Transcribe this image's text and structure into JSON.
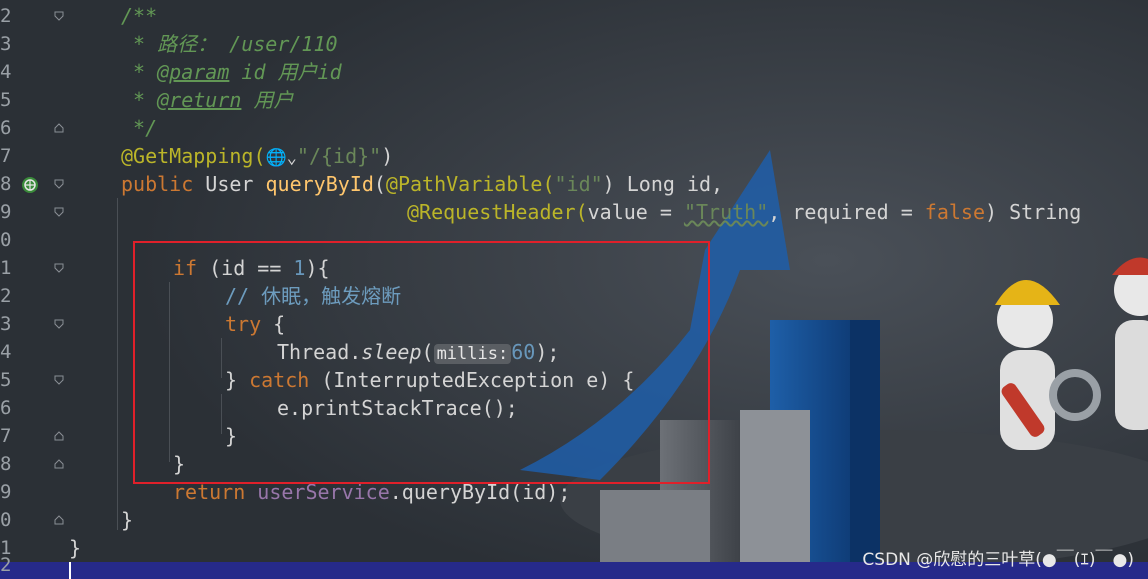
{
  "editor": {
    "lines": [
      {
        "num": "2"
      },
      {
        "num": "3"
      },
      {
        "num": "4"
      },
      {
        "num": "5"
      },
      {
        "num": "6"
      },
      {
        "num": "7"
      },
      {
        "num": "8"
      },
      {
        "num": "9"
      },
      {
        "num": "0"
      },
      {
        "num": "1"
      },
      {
        "num": "2"
      },
      {
        "num": "3"
      },
      {
        "num": "4"
      },
      {
        "num": "5"
      },
      {
        "num": "6"
      },
      {
        "num": "7"
      },
      {
        "num": "8"
      },
      {
        "num": "9"
      },
      {
        "num": "0"
      },
      {
        "num": "1"
      },
      {
        "num": "2"
      }
    ],
    "code": {
      "l1": "/**",
      "l2": " * 路径： /user/110",
      "l3_star": " * ",
      "l3_tag": "@param",
      "l3_rest": " id 用户id",
      "l4_star": " * ",
      "l4_tag": "@return",
      "l4_rest": " 用户",
      "l5": " */",
      "l6_ann": "@GetMapping(",
      "l6_globe": "🌐⌄",
      "l6_str": "\"/{id}\"",
      "l6_close": ")",
      "l7_kw": "public",
      "l7_type": " User ",
      "l7_fn": "queryById",
      "l7_paren": "(",
      "l7_ann": "@PathVariable(",
      "l7_str": "\"id\"",
      "l7_rest": ") Long id,",
      "l8_ann": "@RequestHeader(",
      "l8_a": "value = ",
      "l8_str": "\"Truth\"",
      "l8_b": ", required = ",
      "l8_kw": "false",
      "l8_c": ") String",
      "l10_kw": "if",
      "l10_a": " (id == ",
      "l10_num": "1",
      "l10_b": "){",
      "l11": "// 休眠，触发熔断",
      "l12_kw": "try",
      "l12_b": " {",
      "l13_a": "Thread.",
      "l13_fn": "sleep",
      "l13_b": "(",
      "l13_hint": "millis:",
      "l13_num": "60",
      "l13_c": ");",
      "l14_a": "} ",
      "l14_kw": "catch",
      "l14_b": " (InterruptedException e) {",
      "l15": "e.printStackTrace();",
      "l16": "}",
      "l17": "}",
      "l18_kw": "return",
      "l18_sp": " ",
      "l18_field": "userService",
      "l18_b": ".queryById(id);",
      "l19": "}",
      "l20": "}"
    }
  },
  "icons": {
    "gutter_web": "web-endpoint-icon",
    "fold": "fold-marker-icon"
  },
  "watermark": "CSDN @欣慰的三叶草(●￣(ｴ)￣●)",
  "colors": {
    "background": "#2b3036",
    "keyword": "#cc7832",
    "annotation": "#bbb529",
    "comment": "#629755",
    "string": "#6a8759",
    "number": "#6897bb",
    "function": "#ffc66d",
    "highlight_box": "#e0202a",
    "status_bar": "#262a8a"
  }
}
